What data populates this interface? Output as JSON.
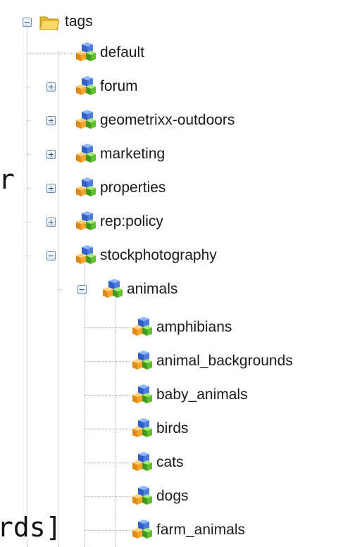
{
  "background_fragments": {
    "left_top": "r",
    "left_bottom": "rds]"
  },
  "tree": {
    "root": {
      "label": "tags",
      "icon": "folder-open-icon",
      "state": "expanded"
    },
    "children": [
      {
        "label": "default",
        "icon": "tag-node-icon",
        "state": "leaf"
      },
      {
        "label": "forum",
        "icon": "tag-node-icon",
        "state": "collapsed"
      },
      {
        "label": "geometrixx-outdoors",
        "icon": "tag-node-icon",
        "state": "collapsed"
      },
      {
        "label": "marketing",
        "icon": "tag-node-icon",
        "state": "collapsed"
      },
      {
        "label": "properties",
        "icon": "tag-node-icon",
        "state": "collapsed"
      },
      {
        "label": "rep:policy",
        "icon": "tag-node-icon",
        "state": "collapsed"
      },
      {
        "label": "stockphotography",
        "icon": "tag-node-icon",
        "state": "expanded"
      }
    ],
    "stockphotography_children": [
      {
        "label": "animals",
        "icon": "tag-node-icon",
        "state": "expanded"
      }
    ],
    "animals_children": [
      {
        "label": "amphibians",
        "icon": "tag-node-icon",
        "state": "leaf"
      },
      {
        "label": "animal_backgrounds",
        "icon": "tag-node-icon",
        "state": "leaf"
      },
      {
        "label": "baby_animals",
        "icon": "tag-node-icon",
        "state": "leaf"
      },
      {
        "label": "birds",
        "icon": "tag-node-icon",
        "state": "leaf"
      },
      {
        "label": "cats",
        "icon": "tag-node-icon",
        "state": "leaf"
      },
      {
        "label": "dogs",
        "icon": "tag-node-icon",
        "state": "leaf"
      },
      {
        "label": "farm_animals",
        "icon": "tag-node-icon",
        "state": "leaf"
      }
    ]
  },
  "colors": {
    "folder": "#f2c94c",
    "cube_blue": "#3f6fd6",
    "cube_green": "#5fbf2f",
    "cube_orange": "#f0a020"
  }
}
